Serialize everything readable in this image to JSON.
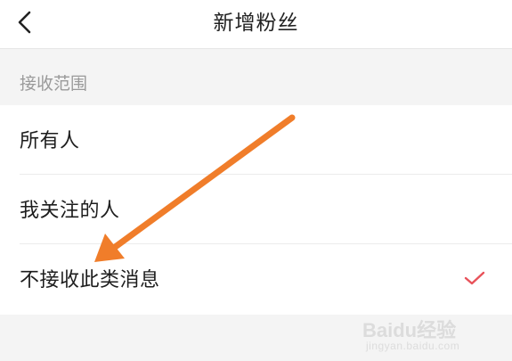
{
  "header": {
    "title": "新增粉丝",
    "back_icon": "chevron-left-icon"
  },
  "section": {
    "label": "接收范围"
  },
  "options": [
    {
      "label": "所有人",
      "selected": false
    },
    {
      "label": "我关注的人",
      "selected": false
    },
    {
      "label": "不接收此类消息",
      "selected": true
    }
  ],
  "check_icon": "checkmark-icon",
  "colors": {
    "check": "#e8525a",
    "arrow": "#f07d2a",
    "section_text": "#9a9a9a",
    "background": "#f4f4f4"
  },
  "watermark": {
    "main": "Baidu经验",
    "sub": "jingyan.baidu.com"
  }
}
